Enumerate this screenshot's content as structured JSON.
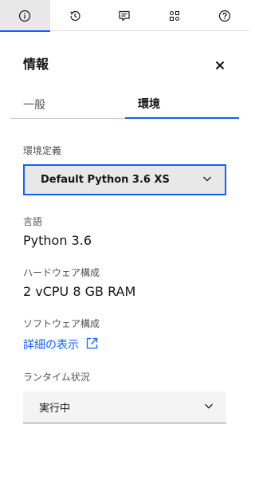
{
  "iconbar": {
    "items": [
      {
        "icon": "info-icon",
        "active": true
      },
      {
        "icon": "history-icon",
        "active": false
      },
      {
        "icon": "comment-icon",
        "active": false
      },
      {
        "icon": "apps-icon",
        "active": false
      },
      {
        "icon": "help-icon",
        "active": false
      }
    ]
  },
  "panel": {
    "title": "情報",
    "close_icon": "close-icon",
    "tabs": [
      {
        "label": "一般",
        "selected": false
      },
      {
        "label": "環境",
        "selected": true
      }
    ]
  },
  "environment": {
    "definition_label": "環境定義",
    "definition_value": "Default Python 3.6 XS",
    "language_label": "言語",
    "language_value": "Python 3.6",
    "hardware_label": "ハードウェア構成",
    "hardware_value": "2 vCPU 8 GB RAM",
    "software_label": "ソフトウェア構成",
    "software_link": "詳細の表示",
    "runtime_label": "ランタイム状況",
    "runtime_value": "実行中"
  },
  "colors": {
    "accent": "#0f62fe",
    "text": "#161616",
    "secondary_text": "#525252"
  }
}
